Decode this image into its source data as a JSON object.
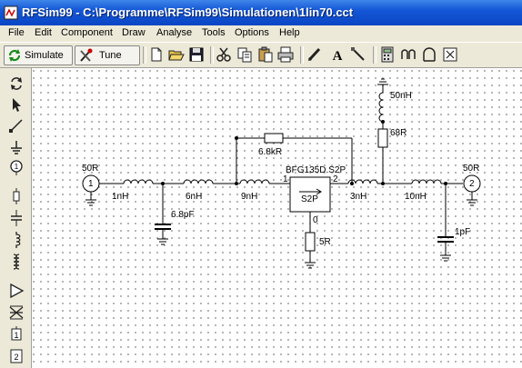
{
  "window": {
    "title": "RFSim99 - C:\\Programme\\RFSim99\\Simulationen\\1lin70.cct"
  },
  "menu": [
    "File",
    "Edit",
    "Component",
    "Draw",
    "Analyse",
    "Tools",
    "Options",
    "Help"
  ],
  "toolbar": {
    "simulate_label": "Simulate",
    "tune_label": "Tune"
  },
  "schematic": {
    "labels": {
      "port1_impedance": "50R",
      "port2_impedance": "50R",
      "port1_number": "1",
      "port2_number": "2",
      "l1": "1nH",
      "l2": "6nH",
      "l3": "9nH",
      "l4": "3nH",
      "l5": "10nH",
      "l6": "50nH",
      "c1": "6.8pF",
      "c2": "1pF",
      "r_feedback": "6.8kR",
      "r_bias": "68R",
      "r_emitter": "5R",
      "transistor_name": "BFG135D.S2P",
      "transistor_block": "S2P",
      "pin1": "1",
      "pin2": "2",
      "pin0": "0"
    }
  }
}
